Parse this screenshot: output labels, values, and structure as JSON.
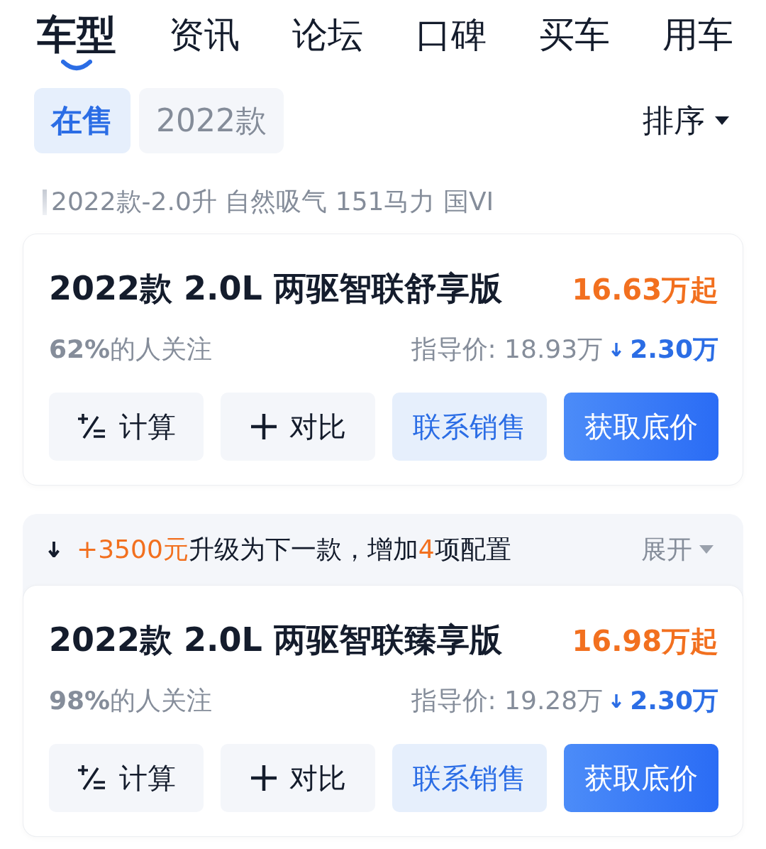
{
  "tabs": [
    {
      "label": "车型",
      "selected": true
    },
    {
      "label": "资讯",
      "selected": false
    },
    {
      "label": "论坛",
      "selected": false
    },
    {
      "label": "口碑",
      "selected": false
    },
    {
      "label": "买车",
      "selected": false
    },
    {
      "label": "用车",
      "selected": false
    }
  ],
  "filters": [
    {
      "label": "在售",
      "selected": true
    },
    {
      "label": "2022款",
      "selected": false
    }
  ],
  "sort": {
    "label": "排序"
  },
  "section_title": "2022款-2.0升 自然吸气 151马力 国VI",
  "cars": [
    {
      "name": "2022款 2.0L 两驱智联舒享版",
      "price": "16.63万起",
      "attention": "**62%**的人关注",
      "guide_price": "指导价: 18.93万",
      "discount": "2.30万",
      "buttons": [
        {
          "label": "计算",
          "kind": "calc"
        },
        {
          "label": "对比",
          "kind": "compare"
        },
        {
          "label": "联系销售",
          "kind": "contact"
        },
        {
          "label": "获取底价",
          "kind": "quote"
        }
      ]
    },
    {
      "upgrade": {
        "parts": [
          {
            "text": "+3500元",
            "highlight": true
          },
          {
            "text": "升级为下一款，增加",
            "highlight": false
          },
          {
            "text": "4",
            "highlight": true
          },
          {
            "text": "项配置",
            "highlight": false
          }
        ],
        "toggle": "展开"
      },
      "name": "2022款 2.0L 两驱智联臻享版",
      "price": "16.98万起",
      "attention": "**98%**的人关注",
      "guide_price": "指导价: 19.28万",
      "discount": "2.30万",
      "buttons": [
        {
          "label": "计算",
          "kind": "calc"
        },
        {
          "label": "对比",
          "kind": "compare"
        },
        {
          "label": "联系销售",
          "kind": "contact"
        },
        {
          "label": "获取底价",
          "kind": "quote"
        }
      ]
    }
  ]
}
